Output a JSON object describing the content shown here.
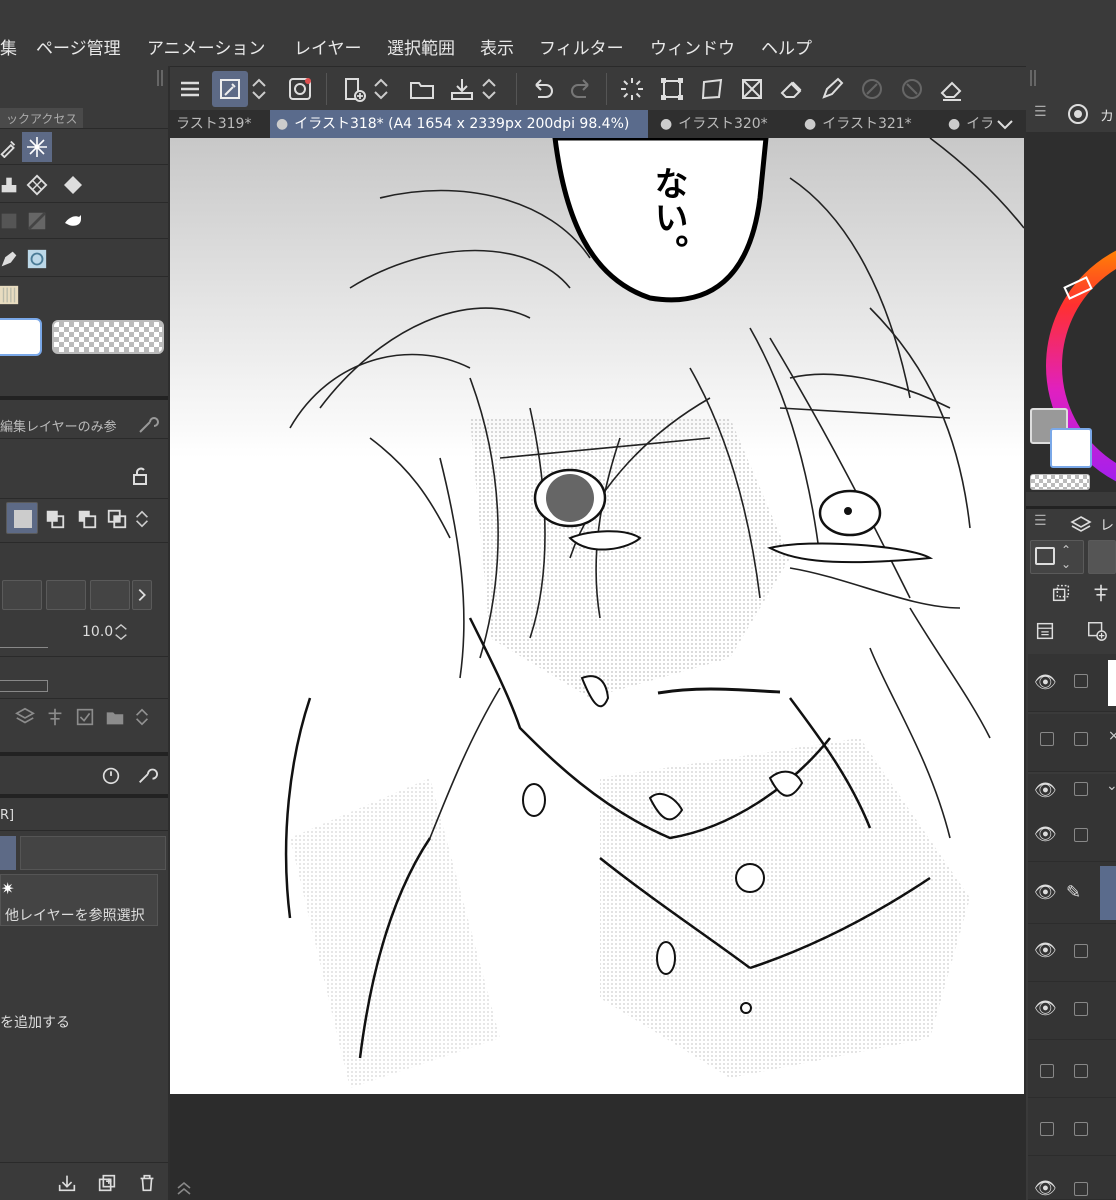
{
  "menu": {
    "items": [
      "集",
      "ページ管理",
      "アニメーション",
      "レイヤー",
      "選択範囲",
      "表示",
      "フィルター",
      "ウィンドウ",
      "ヘルプ"
    ]
  },
  "tabs": [
    {
      "label": "ラスト319*"
    },
    {
      "label": "イラスト318* (A4 1654 x 2339px 200dpi 98.4%)"
    },
    {
      "label": "イラスト320*"
    },
    {
      "label": "イラスト321*"
    },
    {
      "label": "イラ"
    }
  ],
  "left_panel": {
    "quick_access_title": "ックアクセス",
    "sub_tool_header": "編集レイヤーのみ参",
    "brush_size_value": "10.0",
    "tab_label": "R]",
    "ref_select_label": "他レイヤーを参照選択",
    "add_label": "を追加する"
  },
  "right_panel": {
    "color_tab_label": "カ",
    "layer_tab_label": "レ"
  },
  "canvas": {
    "speech_text": "ない。"
  },
  "colors": {
    "menubar_bg": "#3a3a3a",
    "active_tab": "#5a6b8c",
    "active_tool": "#5d6a86",
    "panel_bg": "#3a3a3a"
  }
}
